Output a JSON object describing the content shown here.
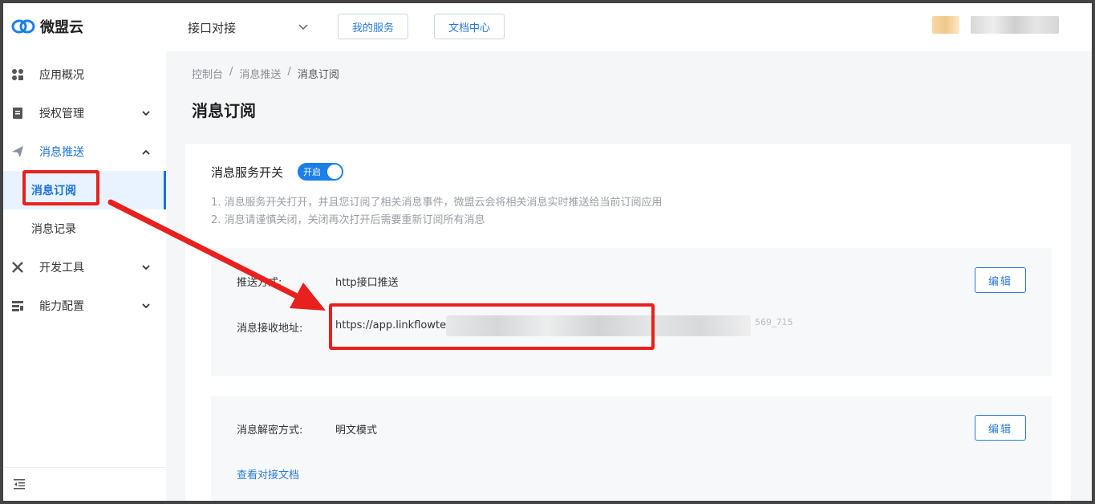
{
  "header": {
    "logo_text": "微盟云",
    "app_select": "接口对接",
    "my_services": "我的服务",
    "docs_center": "文档中心"
  },
  "sidebar": {
    "items": [
      {
        "label": "应用概况",
        "icon": "app-overview-icon"
      },
      {
        "label": "授权管理",
        "icon": "auth-doc-icon"
      },
      {
        "label": "消息推送",
        "icon": "send-icon"
      },
      {
        "label": "消息订阅"
      },
      {
        "label": "消息记录"
      },
      {
        "label": "开发工具",
        "icon": "tools-icon"
      },
      {
        "label": "能力配置",
        "icon": "config-icon"
      }
    ],
    "active_color": "#1a73d9"
  },
  "breadcrumb": [
    "控制台",
    "消息推送",
    "消息订阅"
  ],
  "breadcrumb_sep": "/",
  "page_title": "消息订阅",
  "switch": {
    "label": "消息服务开关",
    "state_text": "开启",
    "on": true
  },
  "tips": [
    "1. 消息服务开关打开，并且您订阅了相关消息事件，微盟云会将相关消息实时推送给当前订阅应用",
    "2. 消息请谨慎关闭，关闭再次打开后需要重新订阅所有消息"
  ],
  "push_section": {
    "method_label": "推送方式:",
    "method_value": "http接口推送",
    "url_label": "消息接收地址:",
    "url_value": "https://app.linkflowte",
    "url_tail": "569_715",
    "edit_label": "编辑"
  },
  "decrypt_section": {
    "label": "消息解密方式:",
    "value": "明文模式",
    "edit_label": "编辑",
    "doc_link": "查看对接文档"
  },
  "colors": {
    "accent": "#1a7fe6",
    "annotation": "#e8201e"
  }
}
